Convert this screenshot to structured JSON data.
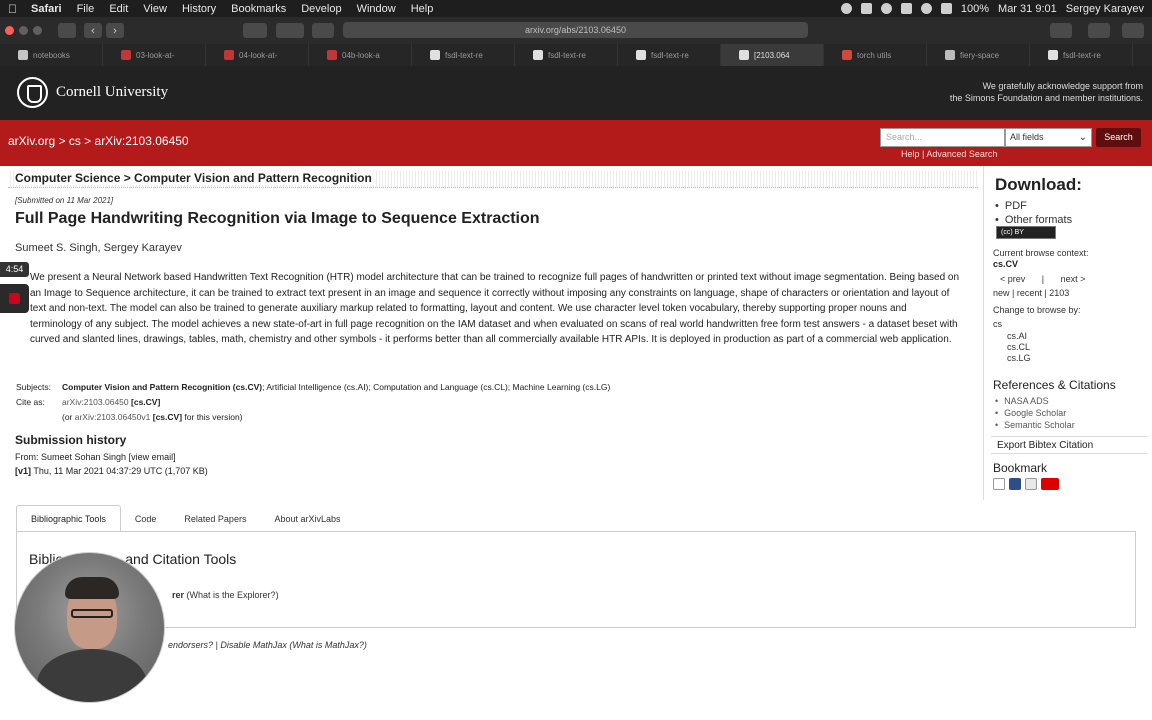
{
  "menubar": {
    "app": "Safari",
    "items": [
      "File",
      "Edit",
      "View",
      "History",
      "Bookmarks",
      "Develop",
      "Window",
      "Help"
    ],
    "battery": "100%",
    "clock": "Mar 31 9:01",
    "user": "Sergey Karayev"
  },
  "browser": {
    "address": "arxiv.org/abs/2103.06450",
    "tabs": [
      {
        "label": "notebooks",
        "color": "#c5c5c5"
      },
      {
        "label": "03-look-at-",
        "color": "#c2363a"
      },
      {
        "label": "04-look-at-",
        "color": "#c2363a"
      },
      {
        "label": "04b-look-a",
        "color": "#c2363a"
      },
      {
        "label": "fsdl-text-re",
        "color": "#e0e0e0"
      },
      {
        "label": "fsdl-text-re",
        "color": "#e0e0e0"
      },
      {
        "label": "fsdl-text-re",
        "color": "#e0e0e0"
      },
      {
        "label": "[2103.064",
        "color": "#e0e0e0"
      },
      {
        "label": "torch utils",
        "color": "#d04a3b"
      },
      {
        "label": "fiery-space",
        "color": "#bbbbbb"
      },
      {
        "label": "fsdl-text-re",
        "color": "#e0e0e0"
      }
    ],
    "active_tab": 7
  },
  "header": {
    "institution": "Cornell University",
    "support_line1": "We gratefully acknowledge support from",
    "support_line2": "the Simons Foundation and member institutions."
  },
  "nav": {
    "crumb_root": "arXiv.org",
    "crumb_sep1": " > ",
    "crumb_cat": "cs",
    "crumb_sep2": " > ",
    "crumb_id": "arXiv:2103.06450",
    "search_placeholder": "Search...",
    "field_select": "All fields",
    "search_button": "Search",
    "help": "Help",
    "help_sep": " | ",
    "advanced": "Advanced Search"
  },
  "paper": {
    "subject_header": "Computer Science > Computer Vision and Pattern Recognition",
    "submitted": "[Submitted on 11 Mar 2021]",
    "title": "Full Page Handwriting Recognition via Image to Sequence Extraction",
    "authors": "Sumeet S. Singh, Sergey Karayev",
    "abstract": "We present a Neural Network based Handwritten Text Recognition (HTR) model architecture that can be trained to recognize full pages of handwritten or printed text without image segmentation. Being based on an Image to Sequence architecture, it can be trained to extract text present in an image and sequence it correctly without imposing any constraints on language, shape of characters or orientation and layout of text and non-text. The model can also be trained to generate auxiliary markup related to formatting, layout and content. We use character level token vocabulary, thereby supporting proper nouns and terminology of any subject. The model achieves a new state-of-art in full page recognition on the IAM dataset and when evaluated on scans of real world handwritten free form test answers - a dataset beset with curved and slanted lines, drawings, tables, math, chemistry and other symbols - it performs better than all commercially available HTR APIs. It is deployed in production as part of a commercial web application.",
    "subjects_label": "Subjects:",
    "subjects_primary": "Computer Vision and Pattern Recognition (cs.CV)",
    "subjects_rest": "; Artificial Intelligence (cs.AI); Computation and Language (cs.CL); Machine Learning (cs.LG)",
    "cite_label": "Cite as:",
    "cite_id": "arXiv:2103.06450",
    "cite_cat": "[cs.CV]",
    "cite_version_pre": "(or ",
    "cite_version_id": "arXiv:2103.06450v1",
    "cite_version_cat": "[cs.CV]",
    "cite_version_post": " for this version)",
    "history_title": "Submission history",
    "history_from": "From: Sumeet Sohan Singh ",
    "history_email": "[view email]",
    "history_v1_tag": "[v1]",
    "history_v1": " Thu, 11 Mar 2021 04:37:29 UTC (1,707 KB)"
  },
  "biblio": {
    "tabs": [
      "Bibliographic Tools",
      "Code",
      "Related Papers",
      "About arXivLabs"
    ],
    "heading": "Biblio",
    "heading_rest": "and Citation Tools",
    "explorer": "rer",
    "explorer_help": "(What is the Explorer?)",
    "footer": "endorsers? | Disable MathJax (What is MathJax?)"
  },
  "sidebar": {
    "download_title": "Download:",
    "download_items": [
      "PDF",
      "Other formats"
    ],
    "license": "(cc) BY",
    "browse_context_label": "Current browse context:",
    "browse_context": "cs.CV",
    "prev": "< prev",
    "sep": "|",
    "next": "next >",
    "new_recent": "new | recent | 2103",
    "change_browse": "Change to browse by:",
    "browse_cs": "cs",
    "browse_sub": [
      "cs.AI",
      "cs.CL",
      "cs.LG"
    ],
    "refs_title": "References & Citations",
    "refs_items": [
      "NASA ADS",
      "Google Scholar",
      "Semantic Scholar"
    ],
    "bibtex": "Export Bibtex Citation",
    "bookmark_title": "Bookmark"
  },
  "overlay": {
    "timer": "4:54"
  },
  "colors": {
    "arxiv_red": "#b31b1b",
    "cornell_bar": "#222222",
    "search_btn": "#5e0e0e",
    "record": "#d0021b"
  }
}
